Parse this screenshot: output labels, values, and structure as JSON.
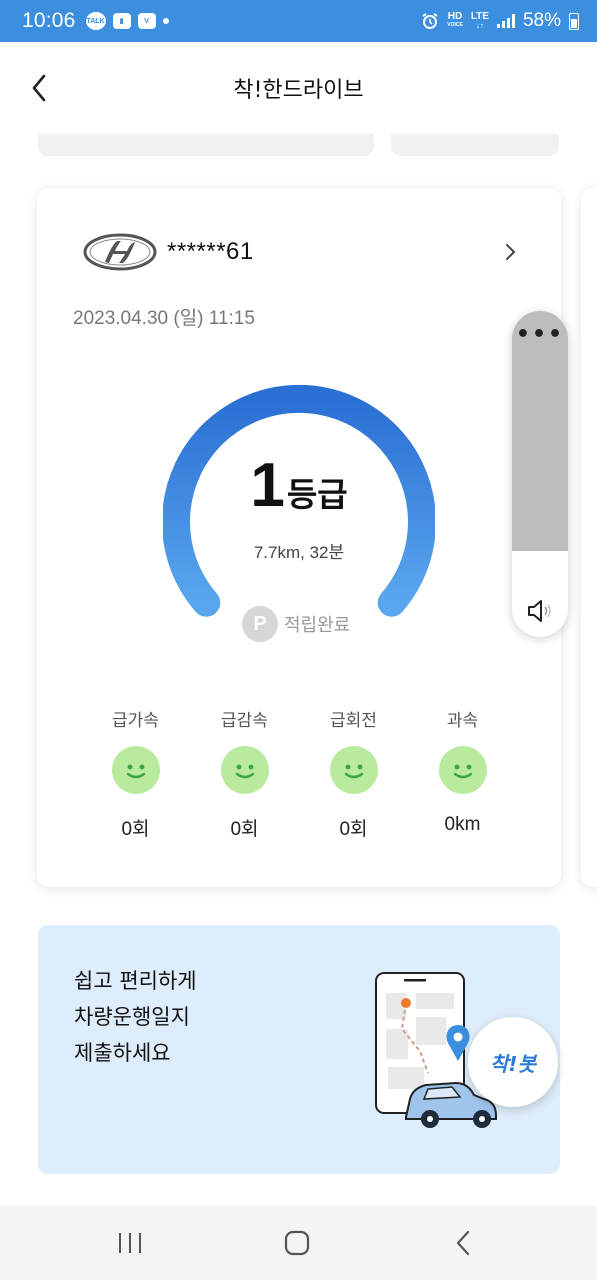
{
  "status_bar": {
    "time": "10:06",
    "left_icons": [
      "talk-icon",
      "notification-icon",
      "v-icon"
    ],
    "hd_label": "HD",
    "voice_label": "VOICE",
    "lte_label": "LTE",
    "battery_percent": "58%",
    "background": "#3b8fde"
  },
  "header": {
    "title": "착!한드라이브"
  },
  "trip_card": {
    "plate": "******61",
    "date": "2023.04.30 (일) 11:15",
    "grade_number": "1",
    "grade_unit": "등급",
    "trip_summary": "7.7km, 32분",
    "point_icon_label": "P",
    "point_status": "적립완료",
    "gauge_colors": {
      "start": "#5aa6ee",
      "end": "#2a6fd4"
    },
    "stats": [
      {
        "label": "급가속",
        "value": "0회",
        "icon": "smiley-icon"
      },
      {
        "label": "급감속",
        "value": "0회",
        "icon": "smiley-icon"
      },
      {
        "label": "급회전",
        "value": "0회",
        "icon": "smiley-icon"
      },
      {
        "label": "과속",
        "value": "0km",
        "icon": "smiley-icon"
      }
    ]
  },
  "volume_panel": {
    "menu_label": "•••",
    "level_fraction": 0.26,
    "icon": "speaker-icon"
  },
  "banner": {
    "line1": "쉽고 편리하게",
    "line2": "차량운행일지",
    "line3": "제출하세요",
    "badge_text": "착!봇",
    "background": "#deedfb"
  },
  "nav_bar": {
    "buttons": [
      "recents-icon",
      "home-icon",
      "back-icon"
    ]
  }
}
